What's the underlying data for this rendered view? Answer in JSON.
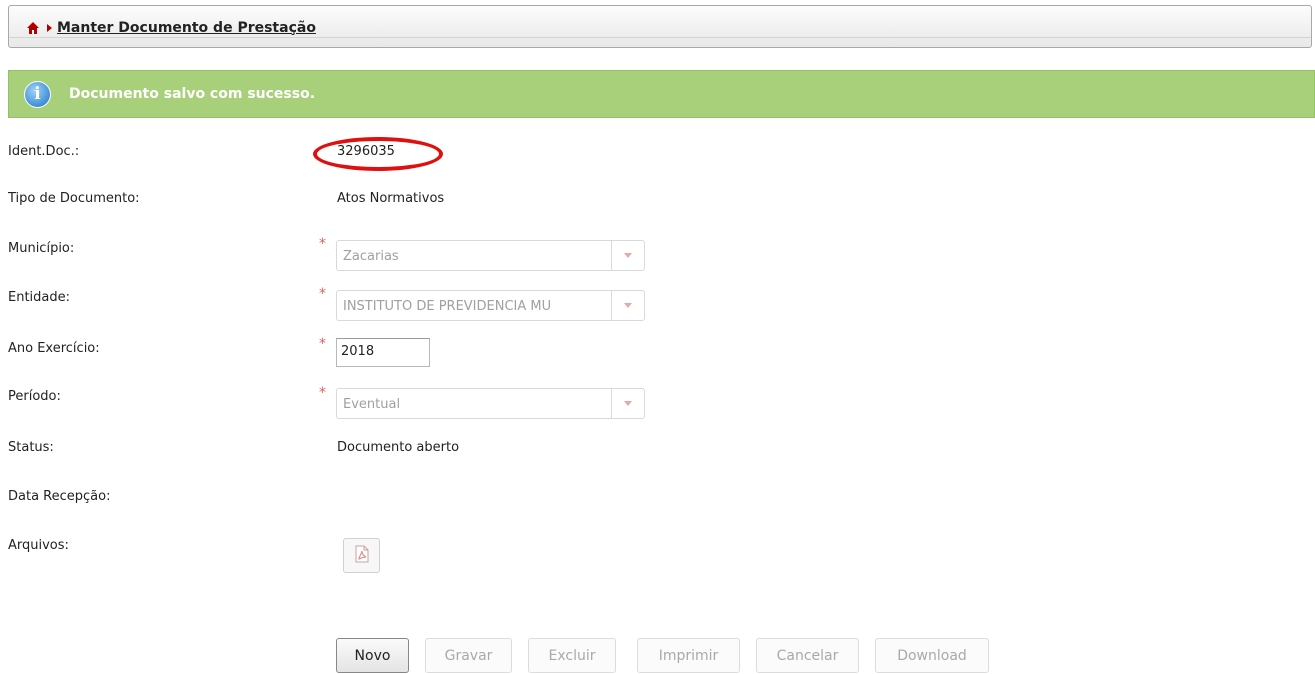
{
  "breadcrumb": {
    "title": "Manter Documento de Prestação",
    "home_icon": "home-icon"
  },
  "alert": {
    "message": "Documento salvo com sucesso.",
    "color": "#a8d07a"
  },
  "form": {
    "ident_label": "Ident.Doc.:",
    "ident_value": "3296035",
    "tipo_label": "Tipo de Documento:",
    "tipo_value": "Atos Normativos",
    "municipio_label": "Município:",
    "municipio_value": "Zacarias",
    "entidade_label": "Entidade:",
    "entidade_value": "INSTITUTO DE PREVIDENCIA MU",
    "ano_label": "Ano Exercício:",
    "ano_value": "2018",
    "periodo_label": "Período:",
    "periodo_value": "Eventual",
    "status_label": "Status:",
    "status_value": "Documento aberto",
    "data_label": "Data Recepção:",
    "arquivos_label": "Arquivos:",
    "required_mark": "*"
  },
  "buttons": {
    "novo": "Novo",
    "gravar": "Gravar",
    "excluir": "Excluir",
    "imprimir": "Imprimir",
    "cancelar": "Cancelar",
    "download": "Download"
  }
}
